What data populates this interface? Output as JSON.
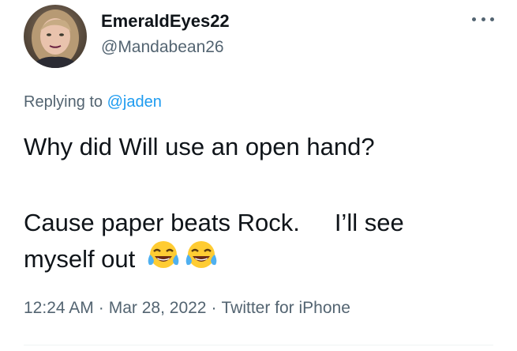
{
  "author": {
    "display_name": "EmeraldEyes22",
    "handle": "@Mandabean26"
  },
  "reply": {
    "prefix": "Replying to ",
    "mention": "@jaden"
  },
  "tweet": {
    "line1": "Why did Will use an open hand?",
    "line2a": "Cause paper beats Rock.",
    "line2b": "I’ll see",
    "line3": "myself out",
    "emojis": [
      "face-with-tears-of-joy",
      "face-with-tears-of-joy"
    ]
  },
  "meta": {
    "time": "12:24 AM",
    "separator": "·",
    "date": "Mar 28, 2022",
    "source": "Twitter for iPhone"
  },
  "icons": {
    "more": "more-horizontal-icon"
  }
}
